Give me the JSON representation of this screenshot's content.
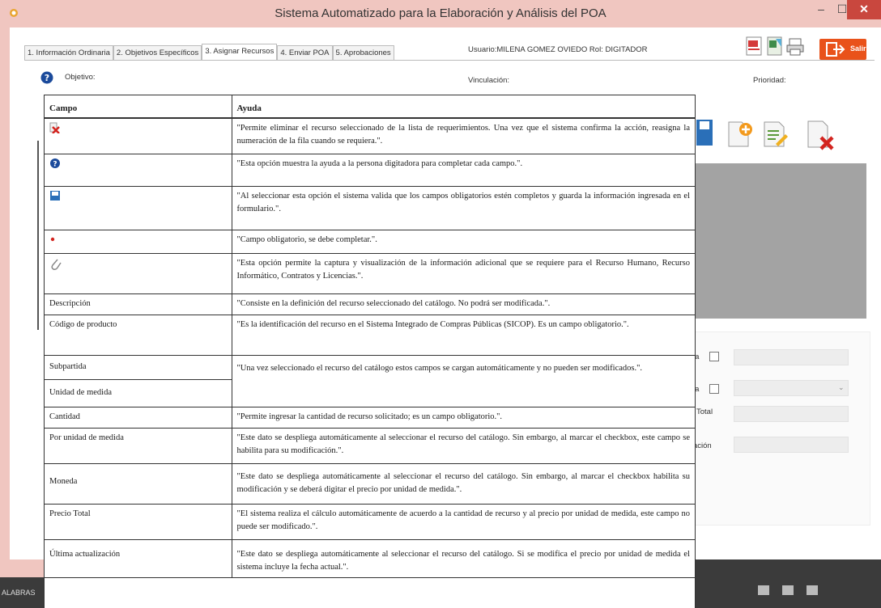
{
  "window": {
    "title": "Sistema Automatizado para la Elaboración y Análisis del POA",
    "min_glyph": "–",
    "max_glyph": "☐",
    "close_glyph": "✕"
  },
  "tabs": [
    {
      "label": "1. Información Ordinaria",
      "active": false
    },
    {
      "label": "2. Objetivos Específicos",
      "active": false
    },
    {
      "label": "3. Asignar Recursos",
      "active": true
    },
    {
      "label": "4. Enviar POA",
      "active": false
    },
    {
      "label": "5. Aprobaciones",
      "active": false
    }
  ],
  "user_info": "Usuario:MILENA GOMEZ OVIEDO  Rol: DIGITADOR",
  "toolbar": {
    "exit_label": "Salir",
    "icons": [
      "pdf-icon",
      "excel-icon",
      "print-icon",
      "exit-icon"
    ]
  },
  "form": {
    "objective_label": "Objetivo:",
    "linkage_label": "Vinculación:",
    "priority_label": "Prioridad:",
    "field_labels": [
      "la",
      "la",
      "Total",
      "ación"
    ]
  },
  "help": {
    "col_field": "Campo",
    "col_help": "Ayuda",
    "rows": [
      {
        "campo": "",
        "icon": "delete-icon",
        "ayuda": "\"Permite eliminar el recurso seleccionado de la lista de requerimientos. Una vez que el sistema confirma la acción, reasigna la numeración de la fila cuando se requiera.\"."
      },
      {
        "campo": "",
        "icon": "help-icon",
        "ayuda": "\"Esta opción muestra la ayuda a la persona digitadora para completar cada campo.\"."
      },
      {
        "campo": "",
        "icon": "save-icon",
        "ayuda": "\"Al seleccionar esta opción el sistema valida que los campos obligatorios estén completos y guarda la información ingresada en el formulario.\"."
      },
      {
        "campo": "",
        "icon": "required-asterisk-icon",
        "ayuda": "\"Campo obligatorio, se debe completar.\"."
      },
      {
        "campo": "",
        "icon": "paperclip-icon",
        "ayuda": "\"Esta opción permite la captura y visualización de la información adicional que se requiere para el Recurso Humano, Recurso Informático, Contratos y Licencias.\"."
      },
      {
        "campo": "Descripción",
        "icon": "",
        "ayuda": "\"Consiste en la definición del recurso seleccionado del catálogo. No podrá ser modificada.\"."
      },
      {
        "campo": "Código de producto",
        "icon": "",
        "ayuda": "\"Es la identificación del recurso en el Sistema Integrado de Compras Públicas (SICOP). Es un campo obligatorio.\"."
      },
      {
        "campo": "Subpartida",
        "campo2": "Unidad de medida",
        "icon": "",
        "ayuda": "\"Una vez seleccionado el recurso del catálogo estos campos se cargan automáticamente y no pueden ser modificados.\"."
      },
      {
        "campo": "Cantidad",
        "icon": "",
        "ayuda": "\"Permite ingresar la cantidad de recurso solicitado; es un campo obligatorio.\"."
      },
      {
        "campo": "Por unidad de medida",
        "icon": "",
        "ayuda": "\"Este dato se despliega automáticamente al seleccionar el recurso del catálogo. Sin embargo, al marcar el checkbox, este campo se habilita para su modificación.\"."
      },
      {
        "campo": "Moneda",
        "icon": "",
        "ayuda": "\"Este dato se despliega automáticamente al seleccionar el recurso del catálogo. Sin embargo, al marcar el checkbox habilita su modificación y se deberá digitar el precio por unidad de medida.\"."
      },
      {
        "campo": "Precio Total",
        "icon": "",
        "ayuda": "\"El sistema realiza el cálculo automáticamente de acuerdo a la cantidad de recurso y al precio por unidad de medida, este campo no puede ser modificado.\"."
      },
      {
        "campo": "Última actualización",
        "icon": "",
        "ayuda": "\"Este dato se despliega automáticamente al seleccionar el recurso del catálogo. Si se modifica el precio por unidad de medida el sistema incluye la fecha actual.\"."
      }
    ]
  },
  "taskbar": {
    "left_text": "ALABRAS"
  },
  "colors": {
    "titlebar": "#f0c6c0",
    "close": "#c9473e",
    "exit_button": "#e9521a",
    "gray_area": "#a3a3a3"
  }
}
